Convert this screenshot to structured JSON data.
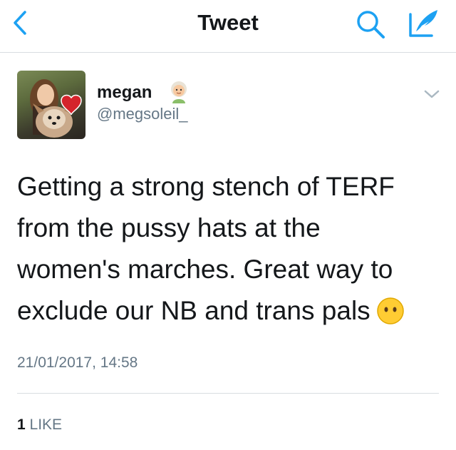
{
  "header": {
    "title": "Tweet",
    "back_icon": "chevron-left-icon",
    "search_icon": "search-icon",
    "compose_icon": "compose-quill-icon",
    "accent_color": "#1da1f2"
  },
  "author": {
    "name": "megan",
    "handle": "@megsoleil_",
    "name_emoji": "older-woman-emoji",
    "avatar_badge": "Repeal",
    "avatar_badge_sub": "the 8th"
  },
  "tweet": {
    "lines": [
      "Getting a strong stench of TERF",
      "from the pussy hats at the",
      "women's marches. Great way to",
      "exclude our NB and trans pals"
    ],
    "trailing_emoji": "face-without-mouth-emoji",
    "timestamp": "21/01/2017, 14:58"
  },
  "stats": {
    "likes_count": "1",
    "likes_label": "LIKE"
  },
  "colors": {
    "text_primary": "#14171a",
    "text_secondary": "#657786",
    "divider": "#d8dde1"
  }
}
